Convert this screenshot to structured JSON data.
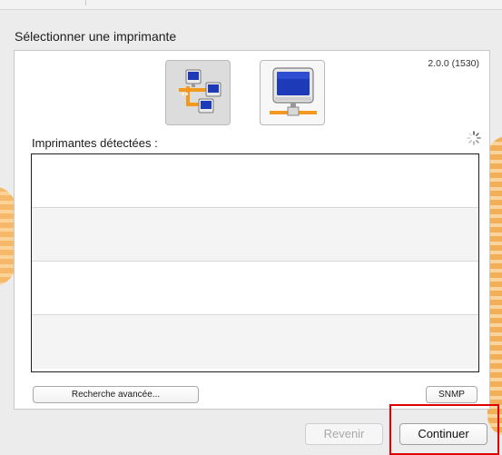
{
  "dialog": {
    "title": "Sélectionner une imprimante",
    "version": "2.0.0 (1530)"
  },
  "connection_modes": [
    {
      "icon": "network-tree-icon",
      "selected": true
    },
    {
      "icon": "usb-computer-icon",
      "selected": false
    }
  ],
  "printers": {
    "label": "Imprimantes détectées :",
    "status_icon": "spinner-icon",
    "rows": [
      "",
      "",
      "",
      ""
    ]
  },
  "buttons": {
    "advanced_search": "Recherche avancée...",
    "snmp": "SNMP",
    "back": "Revenir",
    "continue": "Continuer"
  },
  "highlight": {
    "color": "#e00000",
    "target": "continue-button"
  },
  "colors": {
    "accent_orange": "#f39a1e",
    "screen_blue": "#1d3ab8"
  }
}
